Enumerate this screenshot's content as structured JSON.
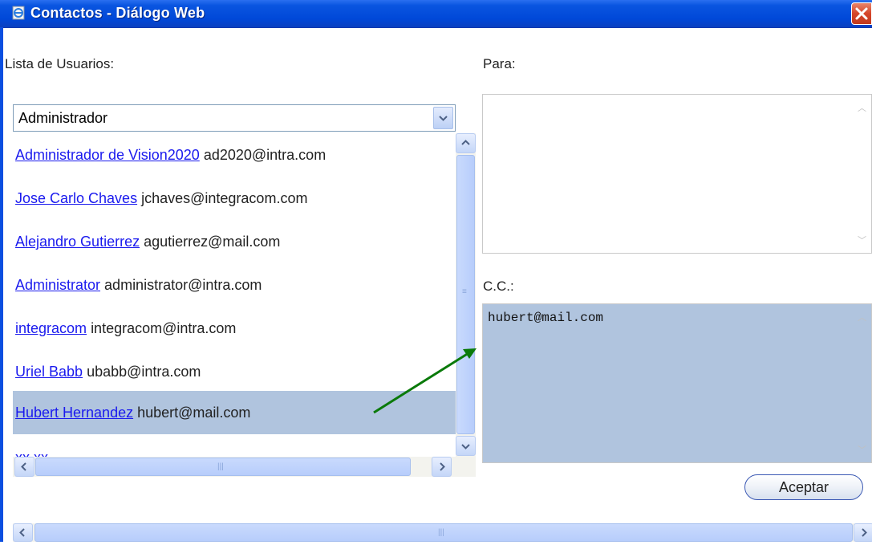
{
  "window": {
    "title": "Contactos - Diálogo Web"
  },
  "labels": {
    "users": "Lista de Usuarios:",
    "to": "Para:",
    "cc": "C.C.:"
  },
  "dropdown": {
    "selected": "Administrador"
  },
  "users": [
    {
      "name": "Administrador de Vision2020",
      "email": "ad2020@intra.com"
    },
    {
      "name": "Jose Carlo Chaves",
      "email": "jchaves@integracom.com"
    },
    {
      "name": "Alejandro Gutierrez",
      "email": "agutierrez@mail.com"
    },
    {
      "name": "Administrator",
      "email": "administrator@intra.com"
    },
    {
      "name": "integracom",
      "email": "integracom@intra.com"
    },
    {
      "name": "Uriel Babb",
      "email": "ubabb@intra.com"
    },
    {
      "name": "Hubert Hernandez",
      "email": "hubert@mail.com",
      "selected": true
    },
    {
      "name": "xx xx",
      "email": ""
    }
  ],
  "fields": {
    "to_value": "",
    "cc_value": "hubert@mail.com"
  },
  "buttons": {
    "accept": "Aceptar"
  },
  "colors": {
    "selection": "#b0c4de",
    "link": "#1a1aee",
    "annotation_arrow": "#0a7a0a"
  }
}
